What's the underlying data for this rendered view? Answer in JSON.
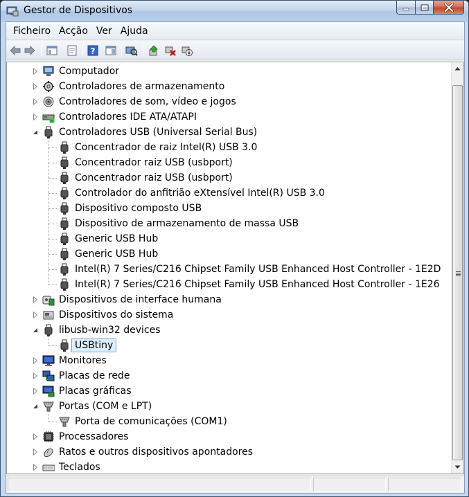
{
  "window": {
    "title": "Gestor de Dispositivos",
    "title_icon": "device-manager-icon"
  },
  "menu": {
    "items": [
      "Ficheiro",
      "Acção",
      "Ver",
      "Ajuda"
    ]
  },
  "toolbar": {
    "buttons": [
      "back-icon",
      "forward-icon",
      "show-hide-console-tree-icon",
      "properties-icon",
      "help-icon",
      "show-action-pane-icon",
      "scan-hardware-changes-icon",
      "update-driver-icon",
      "uninstall-icon",
      "disable-device-icon"
    ]
  },
  "tree": {
    "rows": [
      {
        "label": "Computador",
        "icon": "computer-icon",
        "level": 0,
        "expander": "collapsed"
      },
      {
        "label": "Controladores de armazenamento",
        "icon": "storage-controller-icon",
        "level": 0,
        "expander": "collapsed"
      },
      {
        "label": "Controladores de som, vídeo e jogos",
        "icon": "speaker-icon",
        "level": 0,
        "expander": "collapsed"
      },
      {
        "label": "Controladores IDE ATA/ATAPI",
        "icon": "ide-controller-icon",
        "level": 0,
        "expander": "collapsed"
      },
      {
        "label": "Controladores USB (Universal Serial Bus)",
        "icon": "usb-plug-icon",
        "level": 0,
        "expander": "expanded"
      },
      {
        "label": "Concentrador de raiz Intel(R) USB 3.0",
        "icon": "usb-plug-icon",
        "level": 1
      },
      {
        "label": "Concentrador raiz USB (usbport)",
        "icon": "usb-plug-icon",
        "level": 1
      },
      {
        "label": "Concentrador raiz USB (usbport)",
        "icon": "usb-plug-icon",
        "level": 1
      },
      {
        "label": "Controlador do anfitrião eXtensível Intel(R) USB 3.0",
        "icon": "usb-plug-icon",
        "level": 1
      },
      {
        "label": "Dispositivo composto USB",
        "icon": "usb-plug-icon",
        "level": 1
      },
      {
        "label": "Dispositivo de armazenamento de massa USB",
        "icon": "usb-plug-icon",
        "level": 1
      },
      {
        "label": "Generic USB Hub",
        "icon": "usb-plug-icon",
        "level": 1
      },
      {
        "label": "Generic USB Hub",
        "icon": "usb-plug-icon",
        "level": 1
      },
      {
        "label": "Intel(R) 7 Series/C216 Chipset Family USB Enhanced Host Controller - 1E2D",
        "icon": "usb-plug-icon",
        "level": 1
      },
      {
        "label": "Intel(R) 7 Series/C216 Chipset Family USB Enhanced Host Controller - 1E26",
        "icon": "usb-plug-icon",
        "level": 1
      },
      {
        "label": "Dispositivos de interface humana",
        "icon": "hid-icon",
        "level": 0,
        "expander": "collapsed"
      },
      {
        "label": "Dispositivos do sistema",
        "icon": "system-device-icon",
        "level": 0,
        "expander": "collapsed"
      },
      {
        "label": "libusb-win32 devices",
        "icon": "usb-plug-icon",
        "level": 0,
        "expander": "expanded"
      },
      {
        "label": "USBtiny",
        "icon": "usb-plug-icon",
        "level": 1,
        "selected": true
      },
      {
        "label": "Monitores",
        "icon": "monitor-icon",
        "level": 0,
        "expander": "collapsed"
      },
      {
        "label": "Placas de rede",
        "icon": "network-adapter-icon",
        "level": 0,
        "expander": "collapsed"
      },
      {
        "label": "Placas gráficas",
        "icon": "display-adapter-icon",
        "level": 0,
        "expander": "collapsed"
      },
      {
        "label": "Portas (COM e LPT)",
        "icon": "port-connector-icon",
        "level": 0,
        "expander": "expanded"
      },
      {
        "label": "Porta de comunicações (COM1)",
        "icon": "port-connector-icon",
        "level": 1
      },
      {
        "label": "Processadores",
        "icon": "processor-icon",
        "level": 0,
        "expander": "collapsed"
      },
      {
        "label": "Ratos e outros dispositivos apontadores",
        "icon": "mouse-icon",
        "level": 0,
        "expander": "collapsed"
      },
      {
        "label": "Teclados",
        "icon": "keyboard-icon",
        "level": 0,
        "expander": "collapsed"
      }
    ]
  },
  "colors": {
    "selection_fill": "#ddeeff",
    "selection_border": "#7da2ce",
    "tree_background": "#ffffff"
  }
}
